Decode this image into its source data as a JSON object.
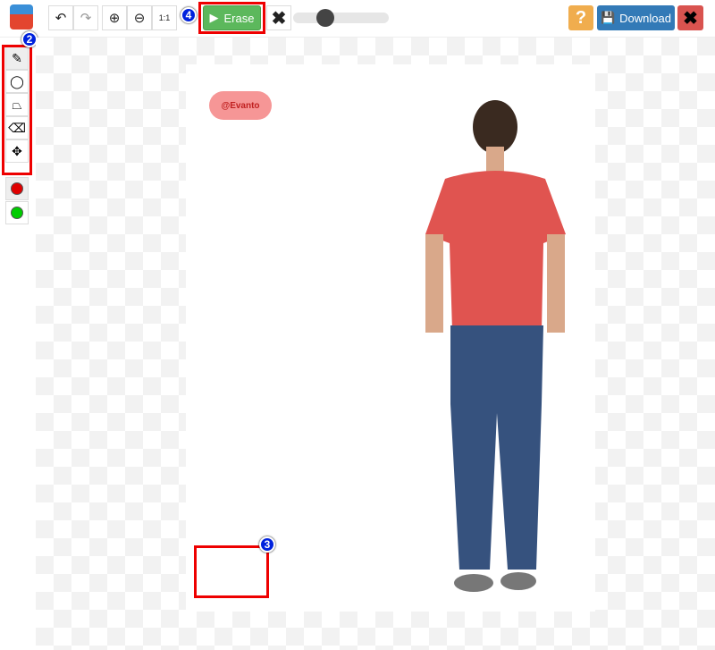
{
  "toolbar": {
    "erase_label": "Erase",
    "download_label": "Download",
    "help_label": "?",
    "brush_size": 0.3
  },
  "badges": {
    "tools": "2",
    "watermark": "3",
    "erase": "4"
  },
  "tools": [
    "brush",
    "lasso",
    "polygon",
    "eraser",
    "move"
  ],
  "colors": {
    "keep": "#00cc00",
    "remove": "#e00000",
    "accent": "#5cb85c",
    "download": "#337ab7"
  },
  "canvas": {
    "watermark_text": "@Evanto"
  }
}
